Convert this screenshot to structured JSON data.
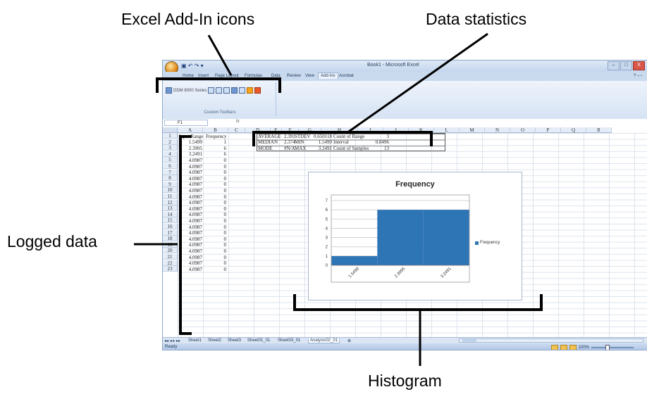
{
  "callouts": {
    "addin_icons": "Excel Add-In icons",
    "data_statistics": "Data statistics",
    "logged_data": "Logged data",
    "histogram": "Histogram"
  },
  "window": {
    "title": "Book1 - Microsoft Excel",
    "minimize": "–",
    "restore": "□",
    "close": "X"
  },
  "ribbon": {
    "tabs": [
      "Home",
      "Insert",
      "Page Layout",
      "Formulas",
      "Data",
      "Review",
      "View",
      "Add-Ins",
      "Acrobat"
    ],
    "active_tab": "Add-Ins",
    "group_label": "Custom Toolbars",
    "addin_name": "DDM 8000 Series"
  },
  "formula_bar": {
    "cell_ref": "F1",
    "fx": "fx",
    "value": ""
  },
  "columns": [
    "A",
    "B",
    "C",
    "D",
    "E",
    "F",
    "G",
    "H",
    "I",
    "J",
    "K",
    "L",
    "M",
    "N",
    "O",
    "P",
    "Q",
    "R"
  ],
  "rows": [
    "1",
    "2",
    "3",
    "4",
    "5",
    "6",
    "7",
    "8",
    "9",
    "10",
    "11",
    "12",
    "13",
    "14",
    "15",
    "16",
    "17",
    "18",
    "19",
    "20",
    "21",
    "22",
    "23"
  ],
  "logged": {
    "header_a": "Input Range",
    "header_b": "Frequency",
    "values": [
      [
        "1.5499",
        "1"
      ],
      [
        "2.3995",
        "6"
      ],
      [
        "3.2491",
        "6"
      ],
      [
        "4.0987",
        "0"
      ],
      [
        "4.0987",
        "0"
      ],
      [
        "4.0987",
        "0"
      ],
      [
        "4.0987",
        "0"
      ],
      [
        "4.0987",
        "0"
      ],
      [
        "4.0987",
        "0"
      ],
      [
        "4.0987",
        "0"
      ],
      [
        "4.0987",
        "0"
      ],
      [
        "4.0987",
        "0"
      ],
      [
        "4.0987",
        "0"
      ],
      [
        "4.0987",
        "0"
      ],
      [
        "4.0987",
        "0"
      ],
      [
        "4.0987",
        "0"
      ],
      [
        "4.0987",
        "0"
      ],
      [
        "4.0987",
        "0"
      ],
      [
        "4.0987",
        "0"
      ],
      [
        "4.0987",
        "0"
      ],
      [
        "4.0987",
        "0"
      ],
      [
        "4.0987",
        "0"
      ]
    ]
  },
  "stats": [
    [
      "AVERAGE",
      "2.391",
      "STDEV",
      "0.650118",
      "Count of Range",
      "3"
    ],
    [
      "MEDIAN",
      "2.374",
      "MIN",
      "1.5499",
      "Interval",
      "0.8496"
    ],
    [
      "MODE",
      "#N/A",
      "MAX",
      "3.2491",
      "Count of Samples",
      "13"
    ]
  ],
  "sheet_tabs": [
    "Sheet1",
    "Sheet2",
    "Sheet3",
    "Sheet01_01",
    "Sheet03_01",
    "Analysis02_01"
  ],
  "active_sheet": "Analysis02_01",
  "status": {
    "ready": "Ready",
    "zoom": "100%"
  },
  "chart_data": {
    "type": "bar",
    "title": "Frequency",
    "categories": [
      "1.5499",
      "2.3995",
      "3.2491"
    ],
    "series": [
      {
        "name": "Frequency",
        "values": [
          1,
          6,
          6
        ]
      }
    ],
    "ylim": [
      0,
      7
    ],
    "yticks": [
      "0",
      "1",
      "2",
      "3",
      "4",
      "5",
      "6",
      "7"
    ],
    "grid": true,
    "legend": "right",
    "color": "#2e75b6"
  }
}
